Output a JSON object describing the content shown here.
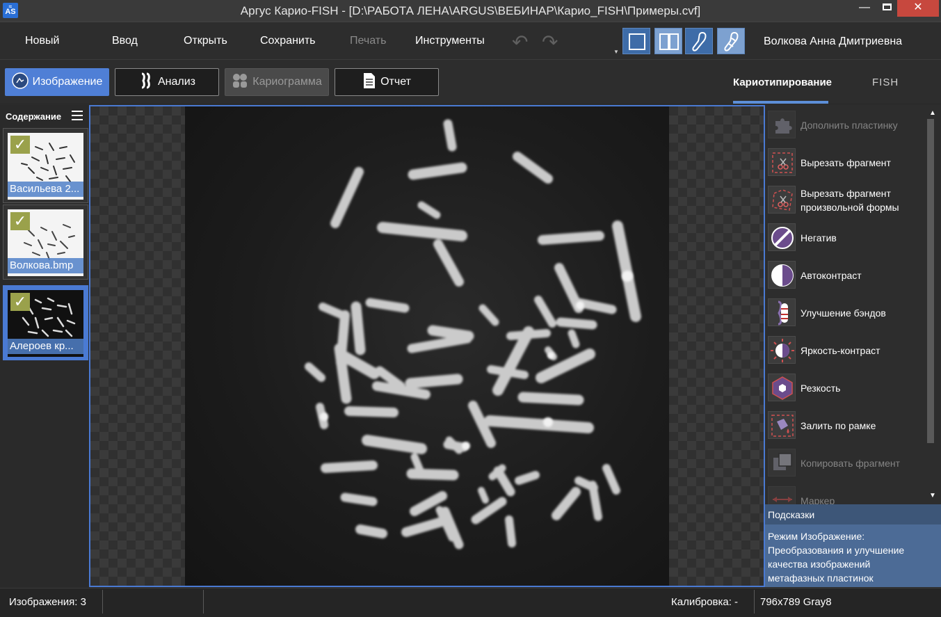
{
  "window": {
    "title": "Аргус Карио-FISH - [D:\\РАБОТА ЛЕНА\\ARGUS\\ВЕБИНАР\\Карио_FISH\\Примеры.cvf]",
    "icon_label": "AS",
    "minimize": "—",
    "close": "✕"
  },
  "menu": {
    "items": [
      "Новый",
      "Ввод",
      "Открыть",
      "Сохранить",
      "Печать",
      "Инструменты"
    ],
    "disabled": [
      "Печать"
    ],
    "undo": "↶",
    "redo": "↷",
    "user": "Волкова Анна Дмитриевна"
  },
  "modes": {
    "buttons": [
      {
        "label": "Изображение",
        "icon": "image-mode-icon"
      },
      {
        "label": "Анализ",
        "icon": "chromosome-icon"
      },
      {
        "label": "Кариограмма",
        "icon": "karyogram-icon"
      },
      {
        "label": "Отчет",
        "icon": "report-icon"
      }
    ],
    "tabs": [
      "Кариотипирование",
      "FISH"
    ]
  },
  "sidebar": {
    "title": "Содержание",
    "images": [
      {
        "label": "Васильева 2...",
        "checked": "✓"
      },
      {
        "label": "Волкова.bmp",
        "checked": "✓"
      },
      {
        "label": "Алероев кр...",
        "checked": "✓"
      }
    ]
  },
  "tools": [
    {
      "label": "Дополнить пластинку",
      "icon": "puzzle-icon",
      "enabled": false
    },
    {
      "label": "Вырезать фрагмент",
      "icon": "scissors-rect-icon",
      "enabled": true
    },
    {
      "label": "Вырезать фрагмент\nпроизвольной формы",
      "icon": "scissors-free-icon",
      "enabled": true
    },
    {
      "label": "Негатив",
      "icon": "negative-icon",
      "enabled": true
    },
    {
      "label": "Автоконтраст",
      "icon": "autocontrast-icon",
      "enabled": true
    },
    {
      "label": "Улучшение бэндов",
      "icon": "bands-icon",
      "enabled": true
    },
    {
      "label": "Яркость-контраст",
      "icon": "brightness-icon",
      "enabled": true
    },
    {
      "label": "Резкость",
      "icon": "sharpness-icon",
      "enabled": true
    },
    {
      "label": "Залить по рамке",
      "icon": "fill-icon",
      "enabled": true
    },
    {
      "label": "Копировать фрагмент",
      "icon": "copy-icon",
      "enabled": false
    },
    {
      "label": "Маркер",
      "icon": "marker-icon",
      "enabled": false
    }
  ],
  "hints": {
    "title": "Подсказки",
    "text": "Режим Изображение:\nПреобразования и улучшение\nкачества изображений\nметафазных пластинок"
  },
  "status": {
    "images_count": "Изображения: 3",
    "calibration": "Калибровка: -",
    "image_info": "796x789 Gray8"
  },
  "colors": {
    "accent": "#4f7fd6",
    "hint_bg": "#4c6b96",
    "close_button": "#c7483e"
  }
}
